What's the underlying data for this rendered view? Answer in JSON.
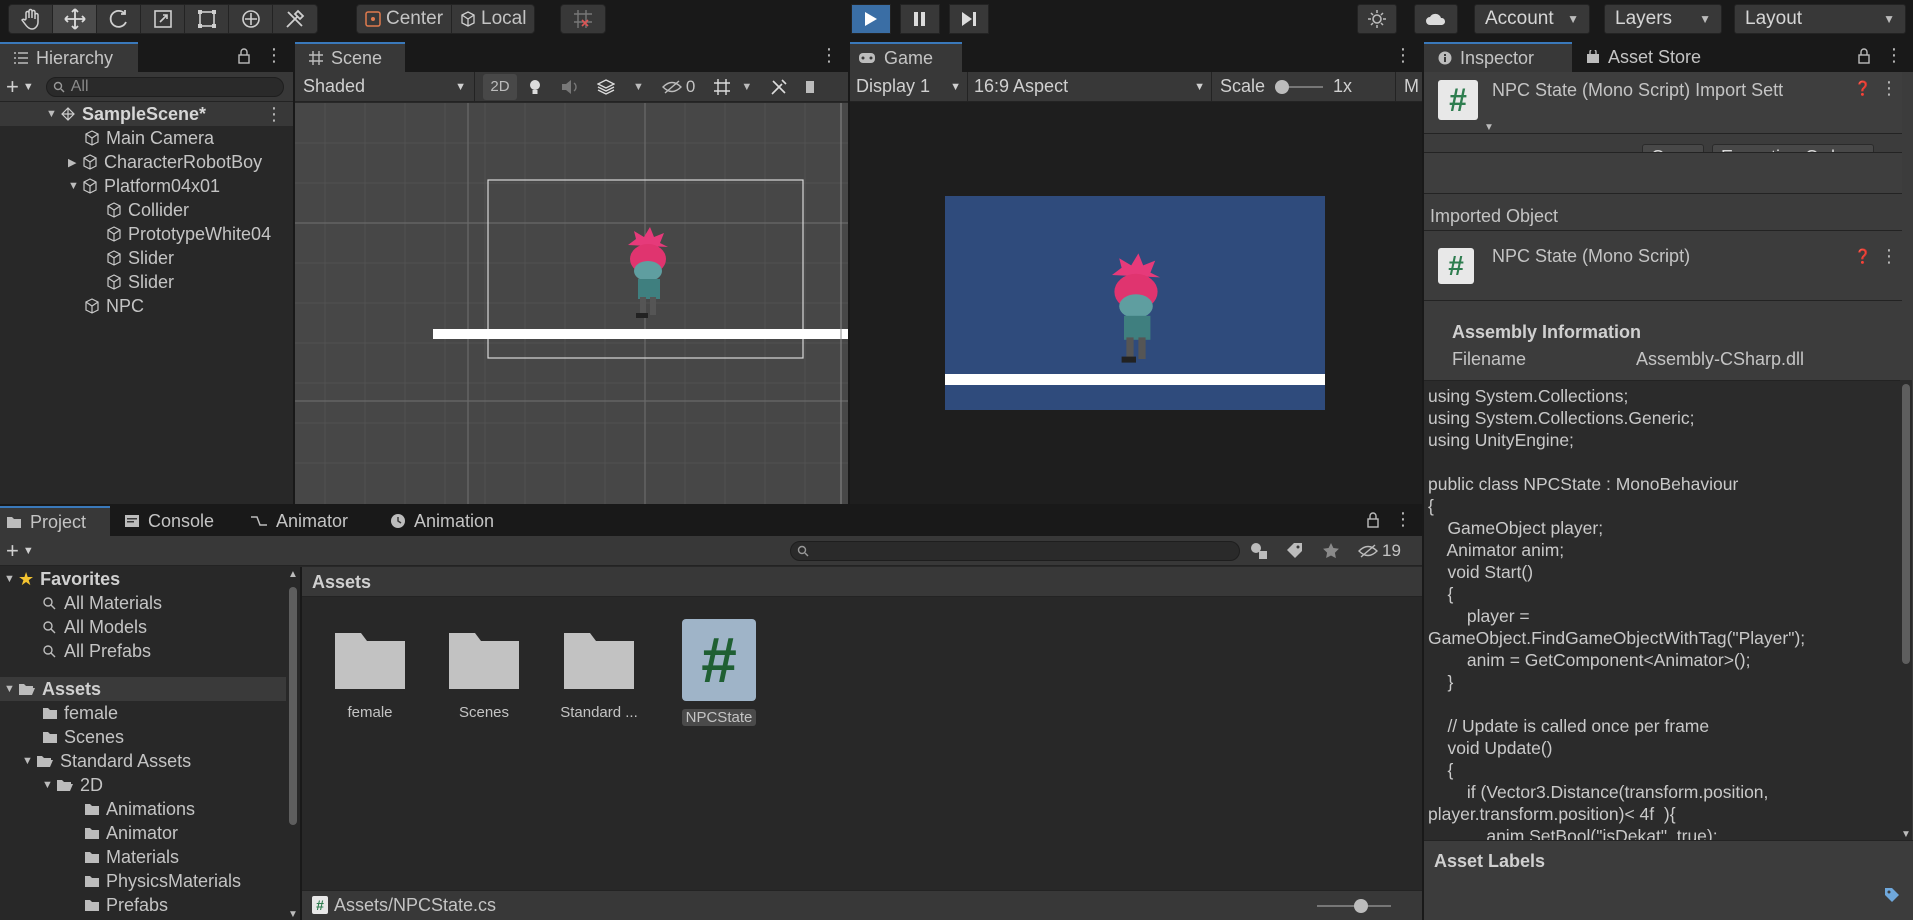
{
  "toolbar": {
    "pivot": "Center",
    "space": "Local",
    "account": "Account",
    "layers": "Layers",
    "layout": "Layout"
  },
  "hierarchy": {
    "tab": "Hierarchy",
    "search_placeholder": "All",
    "scene": "SampleScene*",
    "items": [
      {
        "label": "Main Camera"
      },
      {
        "label": "CharacterRobotBoy"
      },
      {
        "label": "Platform04x01"
      },
      {
        "label": "Collider"
      },
      {
        "label": "PrototypeWhite04"
      },
      {
        "label": "Slider"
      },
      {
        "label": "Slider"
      },
      {
        "label": "NPC"
      }
    ]
  },
  "scene": {
    "tab": "Scene",
    "shading": "Shaded",
    "mode2d": "2D",
    "hidden_count": "0"
  },
  "game": {
    "tab": "Game",
    "display": "Display 1",
    "aspect": "16:9 Aspect",
    "scale_label": "Scale",
    "scale_value": "1x",
    "maximize": "M",
    "bg_color": "#2f4b7c"
  },
  "inspector": {
    "tab": "Inspector",
    "tab2": "Asset Store",
    "title": "NPC State (Mono Script) Import Sett",
    "open": "Open",
    "execution_order": "Execution Order...",
    "imported_object": "Imported Object",
    "script_title": "NPC State (Mono Script)",
    "assembly_header": "Assembly Information",
    "filename_label": "Filename",
    "filename_value": "Assembly-CSharp.dll",
    "code": "using System.Collections;\nusing System.Collections.Generic;\nusing UnityEngine;\n\npublic class NPCState : MonoBehaviour\n{\n    GameObject player;\n    Animator anim;\n    void Start()\n    {\n        player =\nGameObject.FindGameObjectWithTag(\"Player\");\n        anim = GetComponent<Animator>();\n    }\n\n    // Update is called once per frame\n    void Update()\n    {\n        if (Vector3.Distance(transform.position,\nplayer.transform.position)< 4f  ){\n            anim.SetBool(\"isDekat\", true);",
    "asset_labels": "Asset Labels"
  },
  "project": {
    "tabs": [
      "Project",
      "Console",
      "Animator",
      "Animation"
    ],
    "hidden_count": "19",
    "favorites_label": "Favorites",
    "favorites": [
      "All Materials",
      "All Models",
      "All Prefabs"
    ],
    "assets_label": "Assets",
    "tree": [
      {
        "label": "female"
      },
      {
        "label": "Scenes"
      },
      {
        "label": "Standard Assets"
      },
      {
        "label": "2D"
      },
      {
        "label": "Animations"
      },
      {
        "label": "Animator"
      },
      {
        "label": "Materials"
      },
      {
        "label": "PhysicsMaterials"
      },
      {
        "label": "Prefabs"
      }
    ],
    "breadcrumb": "Assets",
    "grid": [
      {
        "label": "female"
      },
      {
        "label": "Scenes"
      },
      {
        "label": "Standard ..."
      },
      {
        "label": "NPCState"
      }
    ],
    "status_path": "Assets/NPCState.cs"
  }
}
